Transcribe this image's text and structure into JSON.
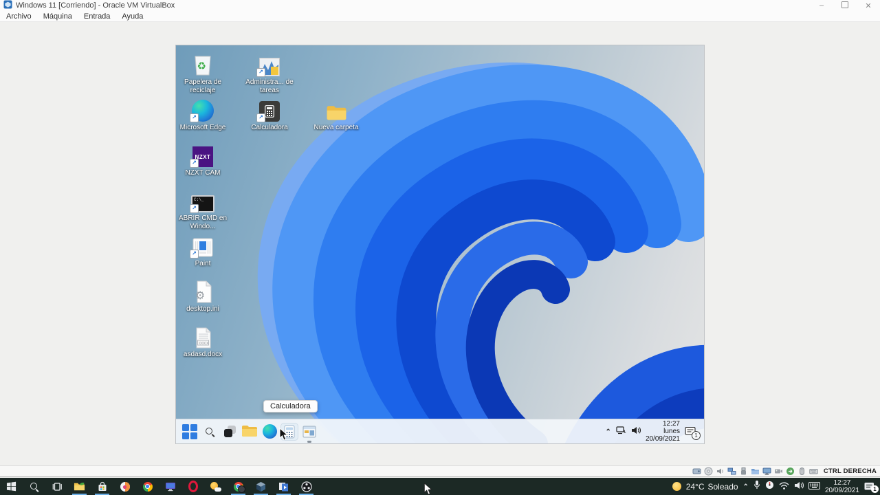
{
  "window": {
    "title": "Windows 11 [Corriendo] - Oracle VM VirtualBox",
    "menu": [
      "Archivo",
      "Máquina",
      "Entrada",
      "Ayuda"
    ]
  },
  "vm": {
    "desktop_icons": [
      {
        "name": "recycle-bin",
        "glyph": "recycle",
        "label": "Papelera de reciclaje",
        "col": 0,
        "row": 0
      },
      {
        "name": "task-manager-shortcut",
        "glyph": "taskmgr",
        "label": "Administra... de tareas",
        "col": 1,
        "row": 0,
        "shortcut": true
      },
      {
        "name": "microsoft-edge",
        "glyph": "edge",
        "label": "Microsoft Edge",
        "col": 0,
        "row": 1,
        "shortcut": true
      },
      {
        "name": "calculator-shortcut",
        "glyph": "calc-dark",
        "label": "Calculadora",
        "col": 1,
        "row": 1,
        "shortcut": true
      },
      {
        "name": "new-folder",
        "glyph": "folder",
        "label": "Nueva carpeta",
        "col": 2,
        "row": 1
      },
      {
        "name": "nzxt-cam-shortcut",
        "glyph": "nzxt",
        "label": "NZXT CAM",
        "col": 0,
        "row": 2,
        "shortcut": true,
        "icon_text": "NZXT"
      },
      {
        "name": "cmd-shortcut",
        "glyph": "cmd",
        "label": "ABRIR CMD en Windo...",
        "col": 0,
        "row": 3,
        "shortcut": true,
        "icon_text": "C:\\_"
      },
      {
        "name": "paint-shortcut",
        "glyph": "paint",
        "label": "Paint",
        "col": 0,
        "row": 4,
        "shortcut": true
      },
      {
        "name": "desktop-ini-file",
        "glyph": "ini",
        "label": "desktop.ini",
        "col": 0,
        "row": 5
      },
      {
        "name": "docx-file",
        "glyph": "docx",
        "label": "asdasd.docx",
        "col": 0,
        "row": 6,
        "icon_text": "DOCX"
      }
    ],
    "tooltip": "Calculadora",
    "taskbar": {
      "icons": [
        {
          "name": "start-button",
          "glyph": "win11-start"
        },
        {
          "name": "search-button",
          "glyph": "search-dark"
        },
        {
          "name": "task-view-button",
          "glyph": "taskview11"
        },
        {
          "name": "file-explorer",
          "glyph": "folder-small"
        },
        {
          "name": "edge-browser",
          "glyph": "edge-small"
        },
        {
          "name": "calculator-app",
          "glyph": "calc-light",
          "hover": true
        },
        {
          "name": "task-manager-app",
          "glyph": "window-app",
          "running": true
        }
      ],
      "tray": {
        "clock": {
          "time": "12:27",
          "day": "lunes",
          "date": "20/09/2021"
        },
        "notification_count": "1"
      }
    }
  },
  "statusbar": {
    "host_key": "CTRL DERECHA",
    "icons": [
      {
        "name": "hard-disks",
        "glyph": "sb-hdd"
      },
      {
        "name": "optical-drives",
        "glyph": "sb-cd"
      },
      {
        "name": "audio",
        "glyph": "sb-audio"
      },
      {
        "name": "network",
        "glyph": "sb-net"
      },
      {
        "name": "usb",
        "glyph": "sb-usb"
      },
      {
        "name": "shared-folders",
        "glyph": "sb-folder"
      },
      {
        "name": "display",
        "glyph": "sb-display"
      },
      {
        "name": "recording",
        "glyph": "sb-rec"
      },
      {
        "name": "features",
        "glyph": "sb-feat"
      },
      {
        "name": "mouse",
        "glyph": "sb-mouse"
      },
      {
        "name": "keyboard",
        "glyph": "sb-kbd"
      }
    ]
  },
  "host": {
    "taskbar_icons": [
      {
        "name": "start-button",
        "glyph": "win10-start"
      },
      {
        "name": "search-button",
        "glyph": "search-light"
      },
      {
        "name": "task-view-button",
        "glyph": "taskview10"
      },
      {
        "name": "files-app",
        "glyph": "folder-green",
        "running": true
      },
      {
        "name": "microsoft-store",
        "glyph": "store",
        "running": true
      },
      {
        "name": "paint-3d",
        "glyph": "paint3d"
      },
      {
        "name": "chrome",
        "glyph": "chrome"
      },
      {
        "name": "nzxt-cam",
        "glyph": "monitor-app"
      },
      {
        "name": "opera",
        "glyph": "opera"
      },
      {
        "name": "weather-app",
        "glyph": "weather"
      },
      {
        "name": "chrome-profile",
        "glyph": "chrome-dark",
        "running": true
      },
      {
        "name": "virtualbox",
        "glyph": "vbox-cube",
        "running": true
      },
      {
        "name": "media-app",
        "glyph": "media-blue",
        "running": true
      },
      {
        "name": "obs-studio",
        "glyph": "obs",
        "running": true
      }
    ],
    "tray": {
      "weather": {
        "temp": "24°C",
        "condition": "Soleado"
      },
      "clock": {
        "time": "12:27",
        "date": "20/09/2021"
      },
      "notification_count": "1"
    }
  }
}
